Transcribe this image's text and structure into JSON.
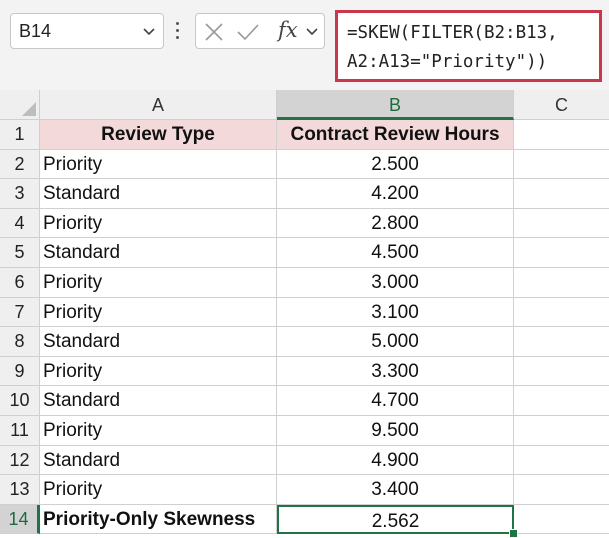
{
  "name_box": {
    "value": "B14"
  },
  "formula_bar": {
    "line1": "=SKEW(FILTER(B2:B13,",
    "line2": "A2:A13=\"Priority\"))",
    "fx_label": "fx"
  },
  "columns": [
    "A",
    "B",
    "C"
  ],
  "selected_column": "B",
  "rows": [
    {
      "num": "1",
      "a": "Review Type",
      "b": "Contract Review Hours"
    },
    {
      "num": "2",
      "a": "Priority",
      "b": "2.500"
    },
    {
      "num": "3",
      "a": "Standard",
      "b": "4.200"
    },
    {
      "num": "4",
      "a": "Priority",
      "b": "2.800"
    },
    {
      "num": "5",
      "a": "Standard",
      "b": "4.500"
    },
    {
      "num": "6",
      "a": "Priority",
      "b": "3.000"
    },
    {
      "num": "7",
      "a": "Priority",
      "b": "3.100"
    },
    {
      "num": "8",
      "a": "Standard",
      "b": "5.000"
    },
    {
      "num": "9",
      "a": "Priority",
      "b": "3.300"
    },
    {
      "num": "10",
      "a": "Standard",
      "b": "4.700"
    },
    {
      "num": "11",
      "a": "Priority",
      "b": "9.500"
    },
    {
      "num": "12",
      "a": "Standard",
      "b": "4.900"
    },
    {
      "num": "13",
      "a": "Priority",
      "b": "3.400"
    },
    {
      "num": "14",
      "a": "Priority-Only Skewness",
      "b": "2.562"
    }
  ],
  "selected_row": "14",
  "colors": {
    "header_fill": "#f3d9d9",
    "selection": "#217346",
    "formula_border": "#c8374b"
  }
}
